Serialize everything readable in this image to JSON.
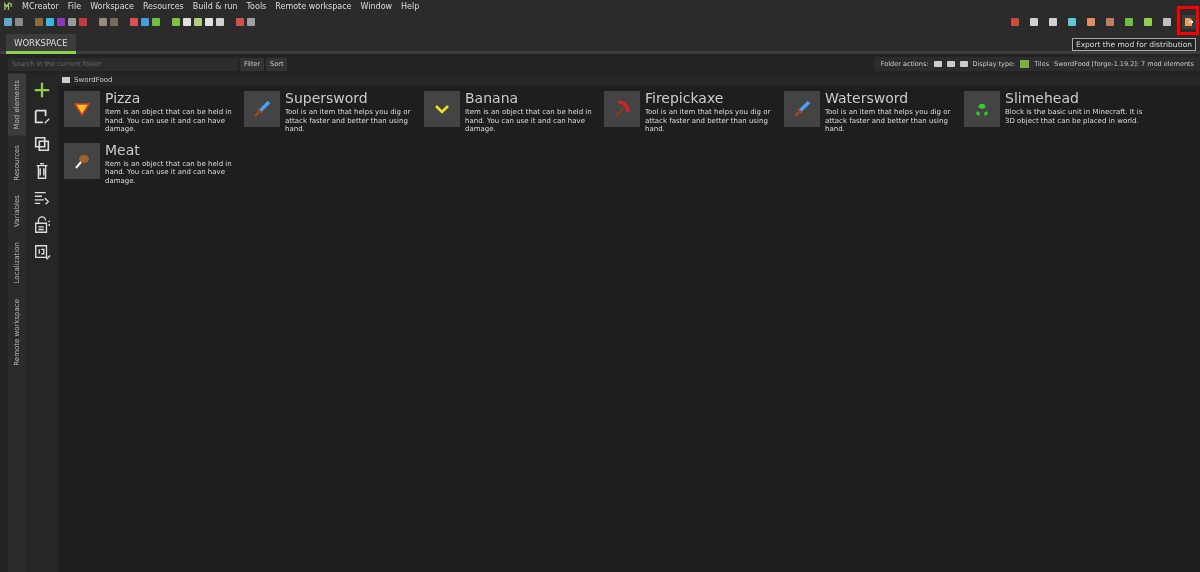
{
  "menu": [
    "MCreator",
    "File",
    "Workspace",
    "Resources",
    "Build & run",
    "Tools",
    "Remote workspace",
    "Window",
    "Help"
  ],
  "tabs": [
    {
      "label": "WORKSPACE",
      "selected": true
    }
  ],
  "export_button": {
    "highlighted": true,
    "tooltip": "Export the mod for distribution"
  },
  "search": {
    "placeholder": "Search in the current folder"
  },
  "buttons": [
    "Filter",
    "Sort"
  ],
  "status": {
    "folder_actions": "Folder actions:",
    "display_type": "Display type:",
    "view": "Tiles",
    "summary": "SwordFood [forge-1.19.2]: 7 mod elements"
  },
  "side_tabs": [
    {
      "label": "Mod elements",
      "selected": true
    },
    {
      "label": "Resources",
      "selected": false
    },
    {
      "label": "Variables",
      "selected": false
    },
    {
      "label": "Localization",
      "selected": false
    },
    {
      "label": "Remote workspace",
      "selected": false
    }
  ],
  "folder": "SwordFood",
  "elements": [
    {
      "name": "Pizza",
      "kind": "pizza",
      "description": "Item is an object that can be held in hand. You can use it and can have damage."
    },
    {
      "name": "Supersword",
      "kind": "sword",
      "description": "Tool is an item that helps you dig or attack faster and better than using hand."
    },
    {
      "name": "Banana",
      "kind": "banana",
      "description": "Item is an object that can be held in hand. You can use it and can have damage."
    },
    {
      "name": "Firepickaxe",
      "kind": "pickaxe",
      "description": "Tool is an item that helps you dig or attack faster and better than using hand."
    },
    {
      "name": "Watersword",
      "kind": "sword",
      "description": "Tool is an item that helps you dig or attack faster and better than using hand."
    },
    {
      "name": "Slimehead",
      "kind": "slime",
      "description": "Block is the basic unit in Minecraft. It is 3D object that can be placed in world."
    },
    {
      "name": "Meat",
      "kind": "meat",
      "description": "Item is an object that can be held in hand. You can use it and can have damage."
    }
  ]
}
